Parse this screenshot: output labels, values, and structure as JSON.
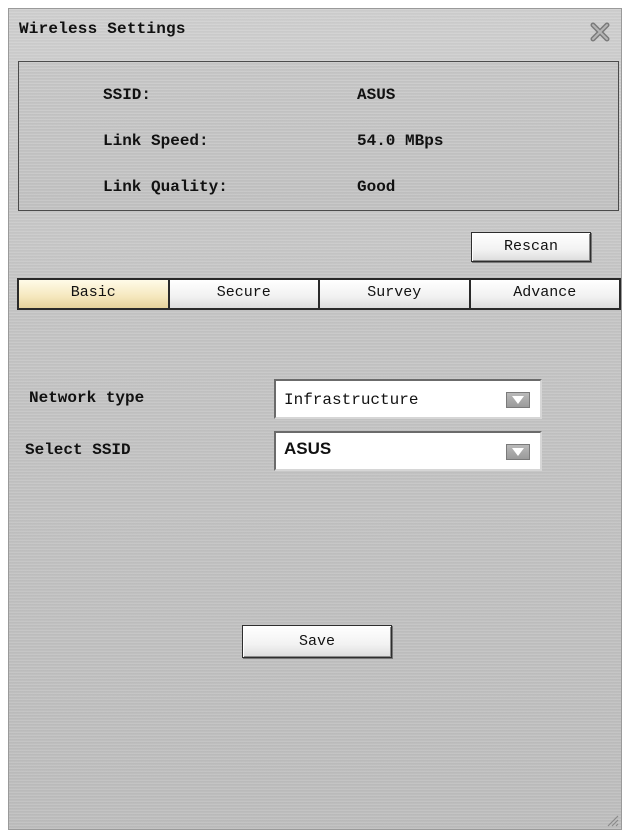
{
  "window": {
    "title": "Wireless Settings"
  },
  "info": {
    "ssid_label": "SSID:",
    "ssid_value": "ASUS",
    "speed_label": "Link Speed:",
    "speed_value": "54.0 MBps",
    "quality_label": "Link Quality:",
    "quality_value": "Good"
  },
  "actions": {
    "rescan_label": "Rescan",
    "save_label": "Save"
  },
  "tabs": [
    {
      "label": "Basic",
      "active": true
    },
    {
      "label": "Secure",
      "active": false
    },
    {
      "label": "Survey",
      "active": false
    },
    {
      "label": "Advance",
      "active": false
    }
  ],
  "form": {
    "network_type_label": "Network type",
    "network_type_value": "Infrastructure",
    "select_ssid_label": "Select SSID",
    "select_ssid_value": "ASUS"
  },
  "colors": {
    "active_tab": "#f5e7bd",
    "panel_bg": "#c4c4c4"
  },
  "icons": {
    "close": "close-icon",
    "dropdown": "chevron-down-icon"
  }
}
